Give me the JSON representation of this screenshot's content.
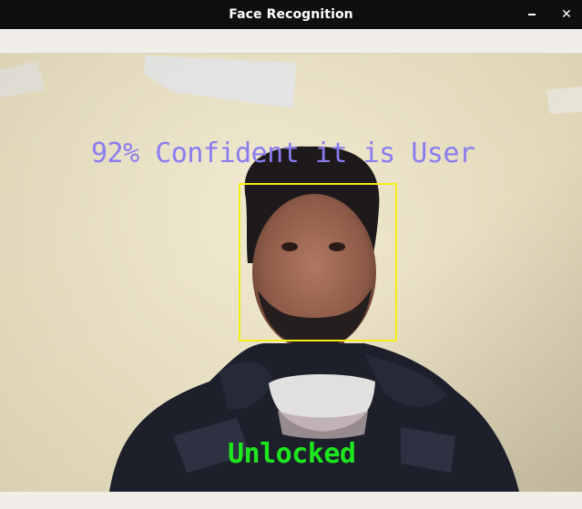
{
  "window": {
    "title": "Face Recognition",
    "controls": {
      "minimize_icon": "minimize-icon",
      "close_glyph": "✕"
    }
  },
  "video_feed": {
    "confidence_text": "92% Confident it is User",
    "status_text": "Unlocked",
    "colors": {
      "confidence_text": "#8a7cf0",
      "status_text": "#1ee61e",
      "face_box": "#f2ee18"
    }
  }
}
